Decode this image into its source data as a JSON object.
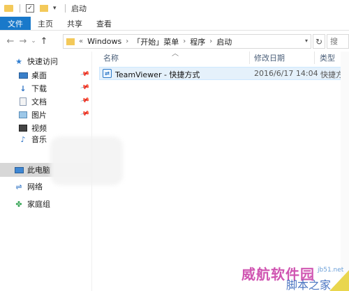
{
  "window": {
    "title": "启动"
  },
  "ribbon": {
    "tabs": [
      "文件",
      "主页",
      "共享",
      "查看"
    ]
  },
  "nav": {
    "back": "←",
    "forward": "→",
    "history": "⌄",
    "up": "↑"
  },
  "address": {
    "prefix": "«",
    "crumbs": [
      "Windows",
      "「开始」菜单",
      "程序",
      "启动"
    ],
    "separator": "›"
  },
  "search": {
    "placeholder": "搜"
  },
  "sidebar": {
    "quick_access": "快速访问",
    "items": [
      {
        "label": "桌面",
        "icon": "desktop-icon",
        "pinned": true
      },
      {
        "label": "下载",
        "icon": "download-icon",
        "pinned": true
      },
      {
        "label": "文档",
        "icon": "document-icon",
        "pinned": true
      },
      {
        "label": "图片",
        "icon": "pictures-icon",
        "pinned": true
      },
      {
        "label": "视频",
        "icon": "video-icon",
        "pinned": false
      },
      {
        "label": "音乐",
        "icon": "music-icon",
        "pinned": false
      }
    ],
    "this_pc": "此电脑",
    "network": "网络",
    "homegroup": "家庭组"
  },
  "columns": {
    "name": "名称",
    "date": "修改日期",
    "type": "类型"
  },
  "files": [
    {
      "name": "TeamViewer - 快捷方式",
      "date": "2016/6/17 14:04",
      "type": "快捷方式"
    }
  ],
  "watermark": {
    "site": "jb51.net",
    "brand": "威航软件园",
    "brand2": "脚本之家"
  },
  "colors": {
    "accent": "#1979ca",
    "selection": "#e5f1fb",
    "folder": "#f3c95a"
  }
}
